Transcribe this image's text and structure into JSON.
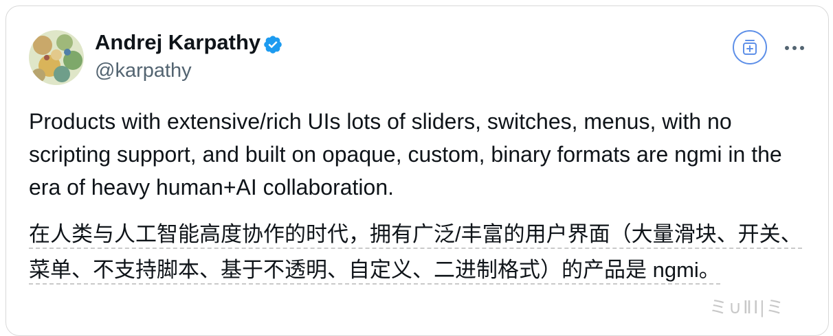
{
  "author": {
    "display_name": "Andrej Karpathy",
    "handle": "@karpathy",
    "avatar_icon": "avatar-image",
    "verified_icon": "verified-badge-icon",
    "verified_color": "#1d9bf0"
  },
  "actions": {
    "add_icon": "add-to-list-icon",
    "more_icon": "more-dots-icon",
    "accent_color": "#5d8fe8"
  },
  "tweet": {
    "text": "Products with extensive/rich UIs lots of sliders, switches, menus, with no scripting support, and built on opaque, custom, binary formats are ngmi in the era of heavy human+AI collaboration."
  },
  "translation": {
    "text": "在人类与人工智能高度协作的时代，拥有广泛/丰富的用户界面（大量滑块、开关、菜单、不支持脚本、基于不透明、自定义、二进制格式）的产品是 ngmi。"
  },
  "watermark": {
    "text": "ミ∪ⅡⅠ|ミ"
  }
}
